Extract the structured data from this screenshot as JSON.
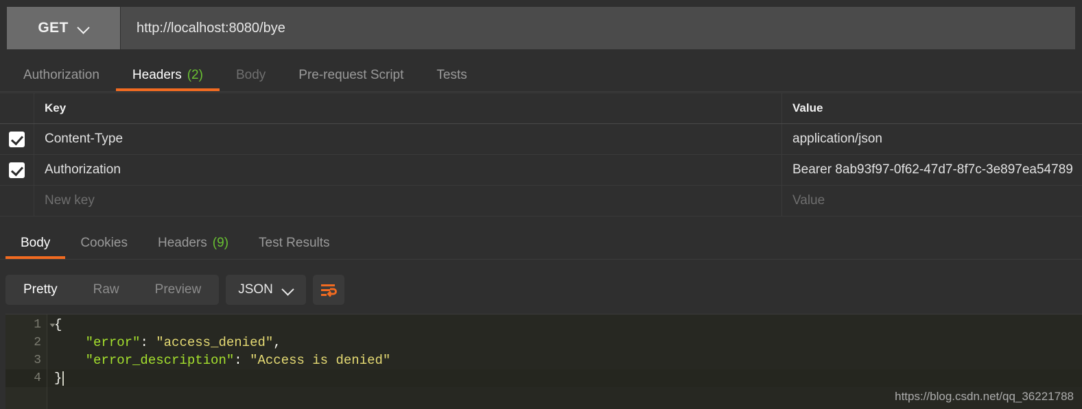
{
  "request": {
    "method": "GET",
    "method_icon": "chevron-down-icon",
    "url": "http://localhost:8080/bye",
    "tabs": [
      {
        "label": "Authorization",
        "count": "",
        "state": "normal"
      },
      {
        "label": "Headers",
        "count": "(2)",
        "state": "active"
      },
      {
        "label": "Body",
        "count": "",
        "state": "dim"
      },
      {
        "label": "Pre-request Script",
        "count": "",
        "state": "normal"
      },
      {
        "label": "Tests",
        "count": "",
        "state": "normal"
      }
    ],
    "headers_table": {
      "columns": {
        "key": "Key",
        "value": "Value"
      },
      "rows": [
        {
          "checked": true,
          "key": "Content-Type",
          "value": "application/json"
        },
        {
          "checked": true,
          "key": "Authorization",
          "value": "Bearer 8ab93f97-0f62-47d7-8f7c-3e897ea54789"
        }
      ],
      "new_row": {
        "key_placeholder": "New key",
        "value_placeholder": "Value"
      }
    }
  },
  "response": {
    "tabs": [
      {
        "label": "Body",
        "count": "",
        "state": "active"
      },
      {
        "label": "Cookies",
        "count": "",
        "state": "normal"
      },
      {
        "label": "Headers",
        "count": "(9)",
        "state": "normal"
      },
      {
        "label": "Test Results",
        "count": "",
        "state": "normal"
      }
    ],
    "format_modes": [
      {
        "label": "Pretty",
        "state": "active"
      },
      {
        "label": "Raw",
        "state": "normal"
      },
      {
        "label": "Preview",
        "state": "normal"
      }
    ],
    "language_selector": {
      "label": "JSON",
      "icon": "chevron-down-icon"
    },
    "wrap_button": {
      "icon": "word-wrap-icon"
    },
    "body_json": {
      "lines": [
        {
          "num": "1",
          "foldable": true,
          "active": false,
          "tokens": [
            {
              "t": "{",
              "c": "p"
            }
          ]
        },
        {
          "num": "2",
          "foldable": false,
          "active": false,
          "tokens": [
            {
              "t": "    ",
              "c": "p"
            },
            {
              "t": "\"error\"",
              "c": "k"
            },
            {
              "t": ": ",
              "c": "p"
            },
            {
              "t": "\"access_denied\"",
              "c": "v"
            },
            {
              "t": ",",
              "c": "p"
            }
          ]
        },
        {
          "num": "3",
          "foldable": false,
          "active": false,
          "tokens": [
            {
              "t": "    ",
              "c": "p"
            },
            {
              "t": "\"error_description\"",
              "c": "k"
            },
            {
              "t": ": ",
              "c": "p"
            },
            {
              "t": "\"Access is denied\"",
              "c": "v"
            }
          ]
        },
        {
          "num": "4",
          "foldable": false,
          "active": true,
          "tokens": [
            {
              "t": "}",
              "c": "p"
            }
          ]
        }
      ]
    }
  },
  "watermark": "https://blog.csdn.net/qq_36221788",
  "colors": {
    "accent_orange": "#f26b21",
    "count_green": "#69c132",
    "json_key": "#a6e22e",
    "json_string": "#e6db74",
    "editor_bg": "#272822",
    "panel_bg": "#2f2f2f",
    "urlbar_bg": "#4b4b4b",
    "method_bg": "#6b6b6b"
  }
}
